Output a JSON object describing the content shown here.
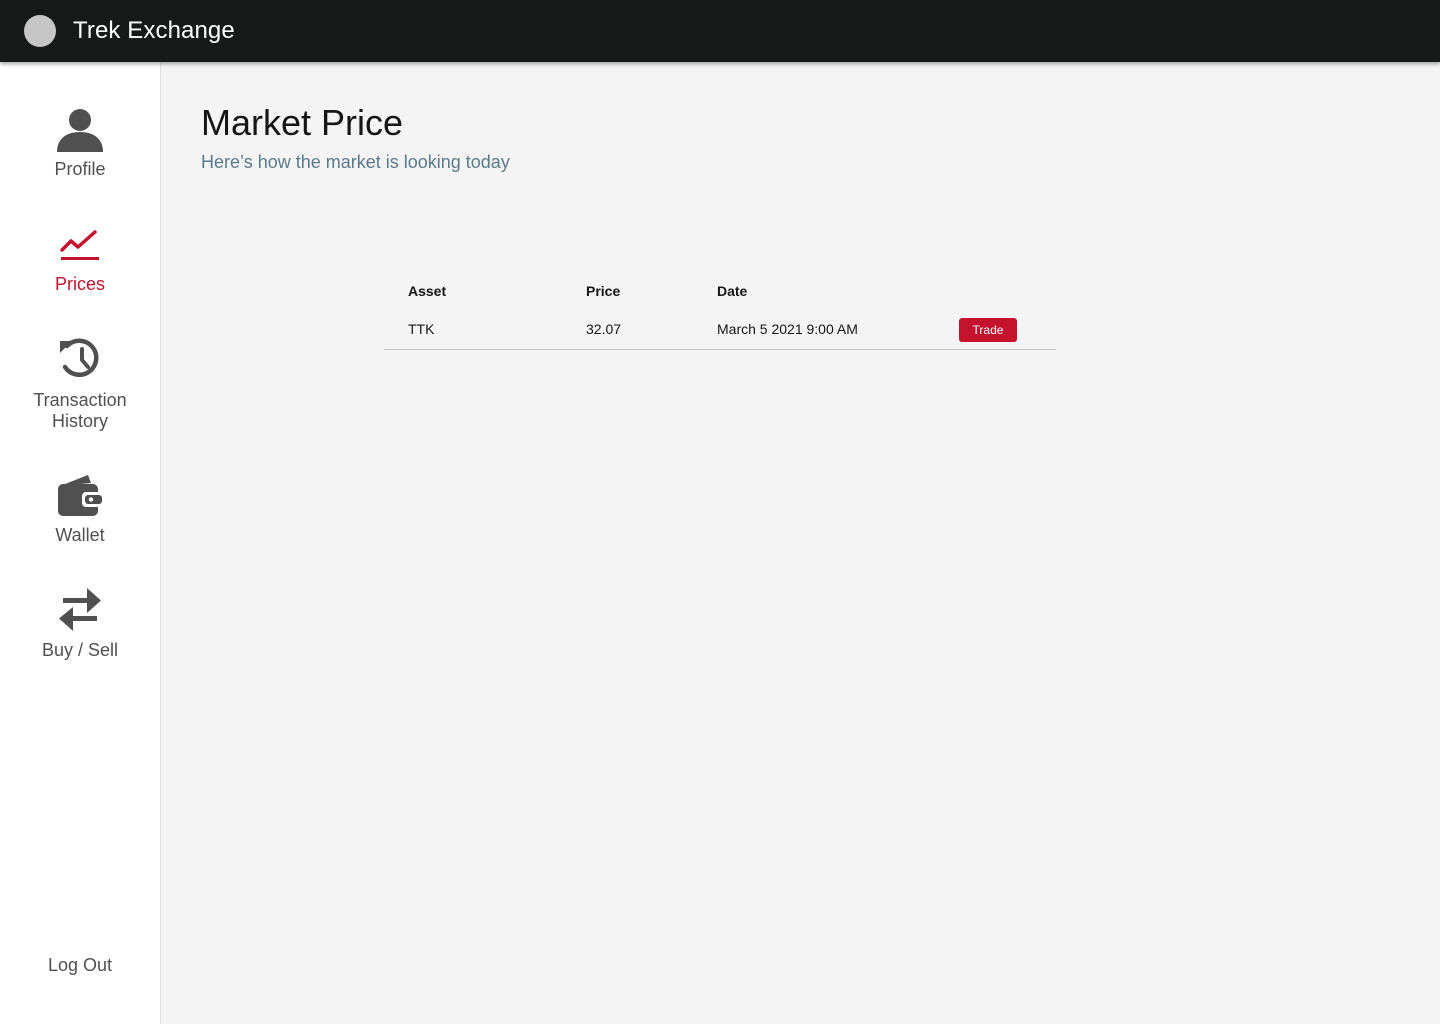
{
  "header": {
    "app_title": "Trek Exchange"
  },
  "sidebar": {
    "items": [
      {
        "label": "Profile",
        "icon": "person-icon",
        "active": false
      },
      {
        "label": "Prices",
        "icon": "chart-line-icon",
        "active": true
      },
      {
        "label": "Transaction History",
        "icon": "history-icon",
        "active": false
      },
      {
        "label": "Wallet",
        "icon": "wallet-icon",
        "active": false
      },
      {
        "label": "Buy / Sell",
        "icon": "swap-arrows-icon",
        "active": false
      }
    ],
    "logout_label": "Log Out"
  },
  "main": {
    "title": "Market Price",
    "subtitle": "Here’s how the market is looking today",
    "table": {
      "columns": [
        "Asset",
        "Price",
        "Date"
      ],
      "rows": [
        {
          "asset": "TTK",
          "price": "32.07",
          "date": "March 5 2021 9:00 AM",
          "action": "Trade"
        }
      ]
    }
  },
  "colors": {
    "topbar": "#181a1a",
    "accent": "#c4122f",
    "subtitle": "#5a7a8c",
    "icon": "#505050"
  }
}
